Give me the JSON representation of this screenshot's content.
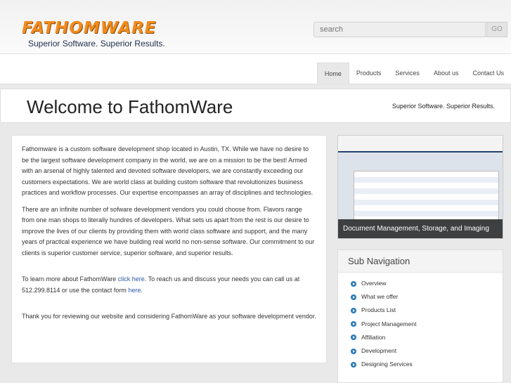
{
  "header": {
    "logo_text": "FATHOMWARE",
    "tagline": "Superior Software. Superior Results.",
    "search_placeholder": "search",
    "go_label": "GO"
  },
  "nav": {
    "items": [
      "Home",
      "Products",
      "Services",
      "About us",
      "Contact Us"
    ]
  },
  "welcome": {
    "title": "Welcome to FathomWare",
    "subtitle": "Superior Software. Superior Results."
  },
  "content": {
    "p1": "Fathomware is a custom software development shop located in Austin, TX. While we have no desire to be the largest software development company in the world, we are on a mission to be the best! Armed with an arsenal of highly talented and devoted software developers, we are constantly exceeding our customers expectations. We are world class at building custom software that revolutionizes business practices and workflow processes. Our expertise encompasses an array of disciplines and technologies.",
    "p2": "There are an infinite number of sofware development vendors you could choose from. Flavors range from one man shops to literally hundres of developers. What sets us apart from the rest is our desire to improve the lives of our clients by providing them with world class software and support, and the many years of practical experience we have building real world no non-sense software. Our commitment to our clients is superior customer service, superior software, and superior results.",
    "p3_a": "To learn more about FathomWare ",
    "p3_link1": "click here",
    "p3_b": ". To reach us and discuss your needs you can call us at 512.299.8114 or use the contact form ",
    "p3_link2": "here",
    "p3_c": ".",
    "p4": "Thank you for reviewing our website and considering FathomWare as your software development vendor."
  },
  "promo": {
    "caption": "Document Management, Storage, and Imaging"
  },
  "subnav": {
    "title": "Sub Navigation",
    "items": [
      "Overview",
      "What we offer",
      "Products List",
      "Project Management",
      "Affiliation",
      "Development",
      "Designing Services"
    ]
  }
}
